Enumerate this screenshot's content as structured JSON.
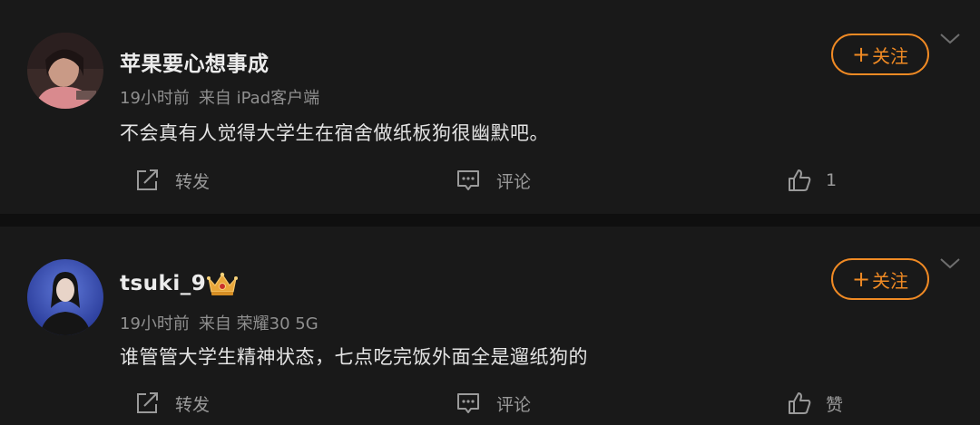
{
  "posts": [
    {
      "username": "苹果要心想事成",
      "time": "19小时前",
      "source": "来自 iPad客户端",
      "content": "不会真有人觉得大学生在宿舍做纸板狗很幽默吧。",
      "follow_plus": "+",
      "follow_label": "关注",
      "repost_label": "转发",
      "comment_label": "评论",
      "like_label": "1",
      "has_vip_badge": false
    },
    {
      "username": "tsuki_9",
      "time": "19小时前",
      "source": "来自 荣耀30 5G",
      "content": "谁管管大学生精神状态，七点吃完饭外面全是遛纸狗的",
      "follow_plus": "+",
      "follow_label": "关注",
      "repost_label": "转发",
      "comment_label": "评论",
      "like_label": "赞",
      "has_vip_badge": true
    }
  ],
  "colors": {
    "background": "#191919",
    "separator": "#0f0f0f",
    "accent_orange": "#f08a24",
    "text_primary": "#e4e4e4",
    "text_secondary": "#8f8f8f",
    "crown_gold": "#e9a63a"
  },
  "icons": {
    "repost": "repost-icon",
    "comment": "comment-icon",
    "like": "thumbs-up-icon",
    "more": "chevron-down-icon",
    "vip": "crown-icon"
  }
}
